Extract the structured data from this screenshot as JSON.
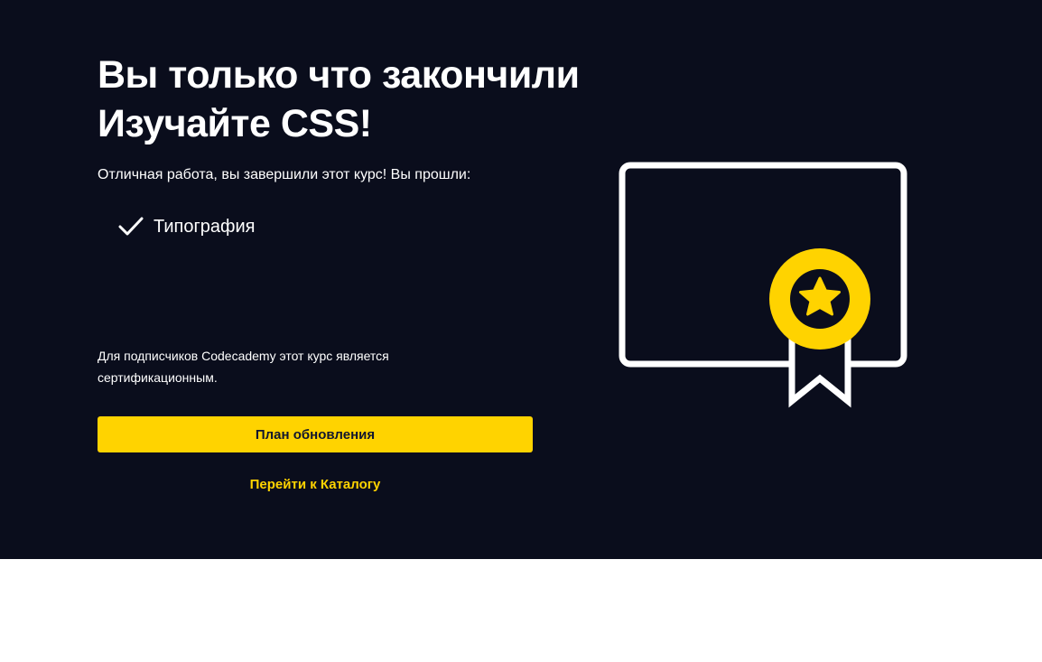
{
  "hero": {
    "title_line1": "Вы только что закончили",
    "title_line2": "Изучайте CSS!",
    "intro": "Отличная работа, вы завершили этот курс! Вы прошли:",
    "completed_items": [
      {
        "label": "Типография",
        "icon": "checkmark-icon"
      }
    ],
    "subscriber_note": "Для подписчиков Codecademy этот курс является сертификационным.",
    "upgrade_label": "План обновления",
    "catalog_label": "Перейти к Каталогу"
  },
  "certificate": {
    "icon": "certificate-badge-icon"
  },
  "colors": {
    "background": "#0a0d1c",
    "accent": "#ffd300",
    "text": "#ffffff",
    "button_text": "#10162f"
  }
}
